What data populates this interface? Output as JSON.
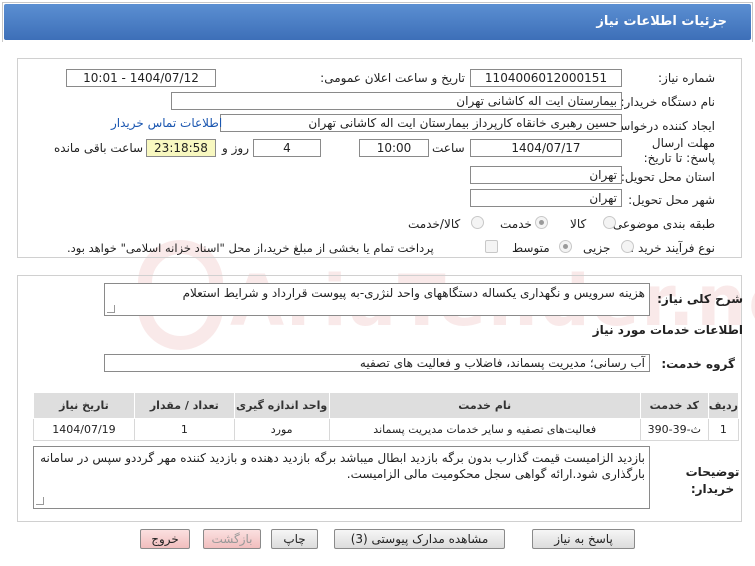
{
  "header": {
    "title": "جزئیات اطلاعات نیاز"
  },
  "watermark": {
    "text": "AriaTender.net"
  },
  "form": {
    "need_number_label": "شماره نیاز:",
    "need_number": "1104006012000151",
    "announce_label": "تاریخ و ساعت اعلان عمومی:",
    "announce_value": "1404/07/12 - 10:01",
    "buyer_label": "نام دستگاه خریدار:",
    "buyer_value": "بیمارستان ایت اله کاشانی تهران",
    "creator_label": "ایجاد کننده درخواست:",
    "creator_value": "حسین رهبری خانقاه کارپرداز بیمارستان ایت اله کاشانی تهران",
    "contact_link": "اطلاعات تماس خریدار",
    "deadline_label": "مهلت ارسال پاسخ: تا تاریخ:",
    "deadline_date": "1404/07/17",
    "time_label": "ساعت",
    "deadline_time": "10:00",
    "days_value": "4",
    "days_label": "روز و",
    "remaining_value": "23:18:58",
    "remaining_label": "ساعت باقی مانده",
    "province_label": "استان محل تحویل:",
    "province_value": "تهران",
    "city_label": "شهر محل تحویل:",
    "city_value": "تهران",
    "category_label": "طبقه بندی موضوعی:",
    "category_options": [
      "کالا",
      "خدمت",
      "کالا/خدمت"
    ],
    "category_selected": "خدمت",
    "process_label": "نوع فرآیند خرید :",
    "process_options": [
      "جزیی",
      "متوسط"
    ],
    "process_selected": "متوسط",
    "payment_note": "پرداخت تمام یا بخشی از مبلغ خرید،از محل \"اسناد خزانه اسلامی\" خواهد بود."
  },
  "details": {
    "summary_label": "شرح کلی نیاز:",
    "summary_value": "هزینه سرویس و نگهداری یکساله دستگاههای واحد لنژری-به پیوست قرارداد و شرایط استعلام",
    "services_heading": "اطلاعات خدمات مورد نیاز",
    "service_group_label": "گروه خدمت:",
    "service_group_value": "آب رسانی؛ مدیریت پسماند، فاضلاب و فعالیت های تصفیه",
    "table": {
      "headers": [
        "ردیف",
        "کد خدمت",
        "نام خدمت",
        "واحد اندازه گیری",
        "تعداد / مقدار",
        "تاریخ نیاز"
      ],
      "rows": [
        [
          "1",
          "ث-39-390",
          "فعالیت‌های تصفیه و سایر خدمات مدیریت پسماند",
          "مورد",
          "1",
          "1404/07/19"
        ]
      ]
    },
    "buyer_notes_label": "توضیحات خریدار:",
    "buyer_notes_value": "بازدید الزامیست قیمت گذارب بدون برگه بازدید ابطال میباشد برگه بازدید دهنده و بازدید کننده مهر گرددو سپس در سامانه بارگذاری شود.ارائه گواهی سجل محکومیت مالی الزامیست."
  },
  "buttons": {
    "reply": "پاسخ به نیاز",
    "attachments": "مشاهده مدارک پیوستی (3)",
    "print": "چاپ",
    "back": "بازگشت",
    "exit": "خروج"
  }
}
